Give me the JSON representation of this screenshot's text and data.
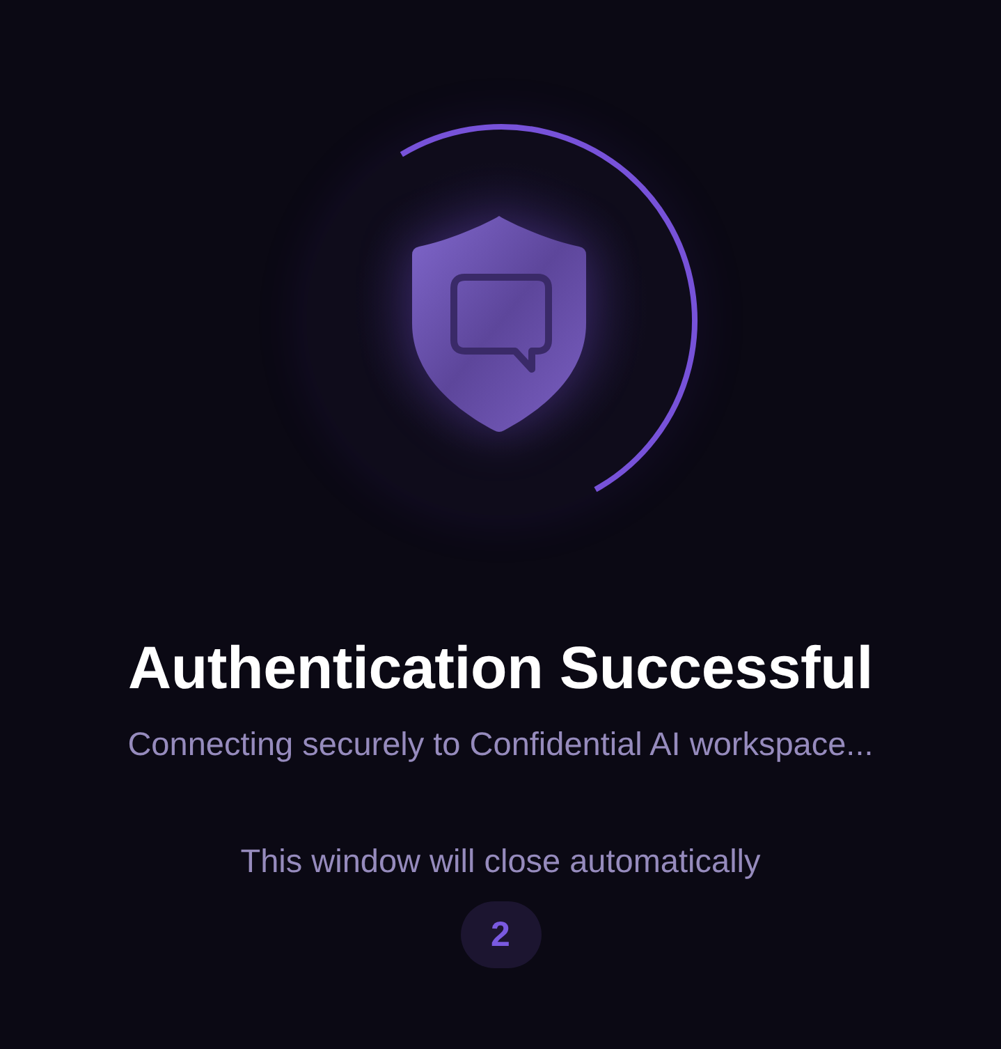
{
  "status": {
    "title": "Authentication Successful",
    "message": "Connecting securely to Confidential AI workspace..."
  },
  "notice": "This window will close automatically",
  "countdown": "2"
}
